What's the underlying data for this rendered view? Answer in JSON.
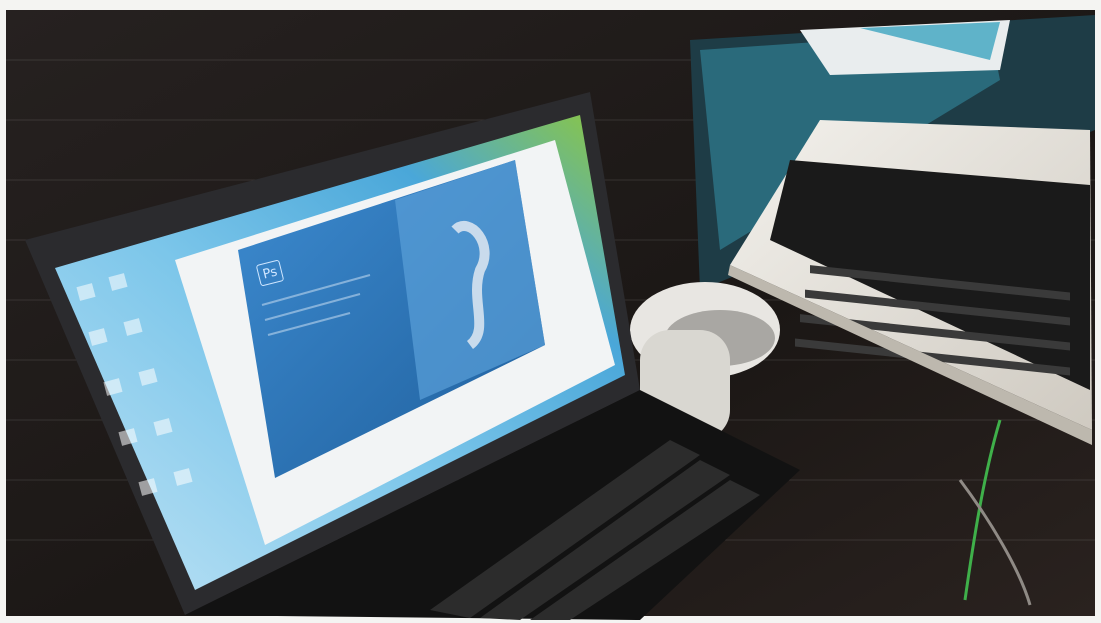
{
  "photo": {
    "laptop_screen": {
      "splash_logo_text": "Ps"
    },
    "colors": {
      "desk": "#1b1715",
      "screen_splash": "#2e73b4",
      "screen_window": "#f2f4f5",
      "wallpaper_green": "#8fc83a",
      "wallpaper_blue": "#4aa7d9",
      "keyboard": "#151515",
      "right_laptop_body": "#e9e6df",
      "cable": "#3fb04a"
    }
  }
}
